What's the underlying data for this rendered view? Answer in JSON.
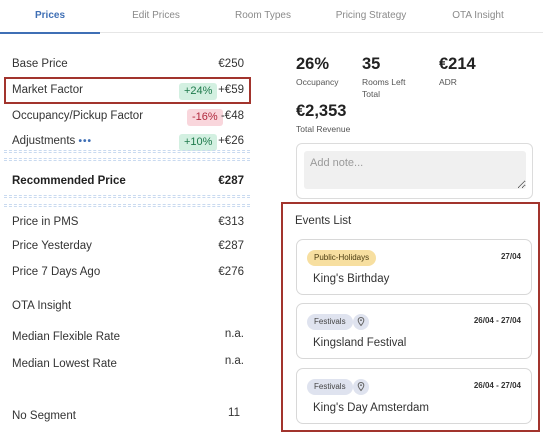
{
  "tabs": [
    {
      "label": "Prices",
      "active": true
    },
    {
      "label": "Edit Prices",
      "active": false
    },
    {
      "label": "Room Types",
      "active": false
    },
    {
      "label": "Pricing Strategy",
      "active": false
    },
    {
      "label": "OTA Insight",
      "active": false
    }
  ],
  "price_breakdown": {
    "base_price": {
      "label": "Base Price",
      "value": "€250"
    },
    "market_factor": {
      "label": "Market Factor",
      "badge": "+24%",
      "value": "+€59"
    },
    "occupancy": {
      "label": "Occupancy/Pickup Factor",
      "badge": "-16%",
      "value": "-€48"
    },
    "adjustments": {
      "label": "Adjustments",
      "dots": "•••",
      "badge": "+10%",
      "value": "+€26"
    },
    "recommended": {
      "label": "Recommended Price",
      "value": "€287"
    }
  },
  "price_info": {
    "pms": {
      "label": "Price in PMS",
      "value": "€313"
    },
    "yesterday": {
      "label": "Price Yesterday",
      "value": "€287"
    },
    "seven_days": {
      "label": "Price 7 Days Ago",
      "value": "€276"
    }
  },
  "ota": {
    "title": "OTA Insight",
    "median_flexible": {
      "label": "Median Flexible Rate",
      "value": "n.a."
    },
    "median_lowest": {
      "label": "Median Lowest Rate",
      "value": "n.a."
    }
  },
  "segment": {
    "label": "No Segment",
    "value": "11"
  },
  "stats": {
    "occupancy": {
      "value": "26%",
      "label": "Occupancy"
    },
    "rooms_left": {
      "value": "35",
      "label_line1": "Rooms Left",
      "label_line2": "Total"
    },
    "adr": {
      "value": "€214",
      "label": "ADR"
    },
    "revenue": {
      "value": "€2,353",
      "label": "Total Revenue"
    }
  },
  "note": {
    "placeholder": "Add note..."
  },
  "events": {
    "title": "Events List",
    "items": [
      {
        "tag": "Public-Holidays",
        "tag_color": "#f7dfa0",
        "date": "27/04",
        "name": "King's Birthday",
        "has_pin": false
      },
      {
        "tag": "Festivals",
        "tag_color": "#dfe3ef",
        "date": "26/04 - 27/04",
        "name": "Kingsland Festival",
        "has_pin": true
      },
      {
        "tag": "Festivals",
        "tag_color": "#dfe3ef",
        "date": "26/04 - 27/04",
        "name": "King's Day Amsterdam",
        "has_pin": true
      }
    ]
  },
  "colors": {
    "accent": "#3f6fb5",
    "highlight_border": "#a2342d"
  },
  "icons": {
    "pin": "location-pin-icon"
  }
}
